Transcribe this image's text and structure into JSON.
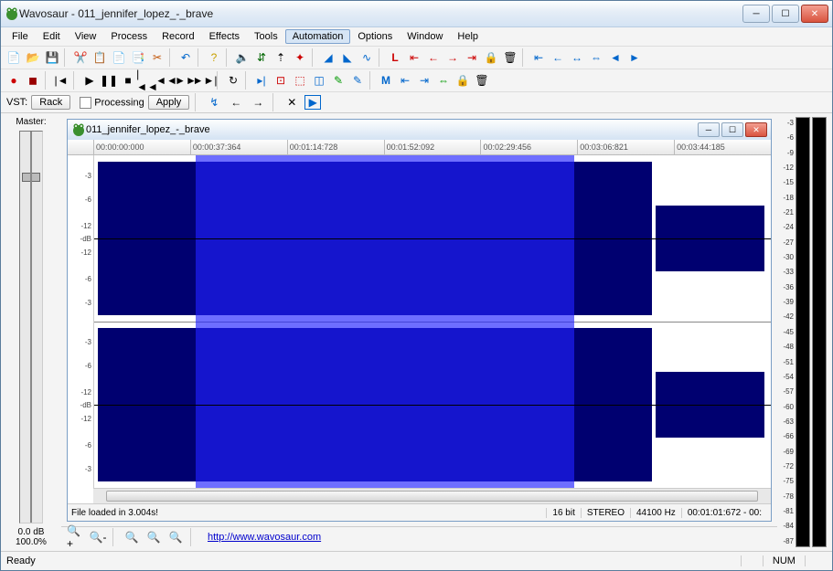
{
  "app": {
    "title": "Wavosaur - 011_jennifer_lopez_-_brave"
  },
  "menu": {
    "file": "File",
    "edit": "Edit",
    "view": "View",
    "process": "Process",
    "record": "Record",
    "effects": "Effects",
    "tools": "Tools",
    "automation": "Automation",
    "options": "Options",
    "window": "Window",
    "help": "Help"
  },
  "vstbar": {
    "label": "VST:",
    "rack": "Rack",
    "processing": "Processing",
    "apply": "Apply"
  },
  "master": {
    "label": "Master:",
    "db": "0.0 dB",
    "pct": "100.0%"
  },
  "child": {
    "title": "011_jennifer_lopez_-_brave"
  },
  "timeruler": [
    "00:00:00:000",
    "00:00:37:364",
    "00:01:14:728",
    "00:01:52:092",
    "00:02:29:456",
    "00:03:06:821",
    "00:03:44:185"
  ],
  "dbscale": [
    "-3",
    "-6",
    "-12",
    "-dB",
    "-12",
    "-6",
    "-3",
    "-3",
    "-6",
    "-12",
    "-dB",
    "-12",
    "-6",
    "-3"
  ],
  "childstatus": {
    "msg": "File loaded in 3.004s!",
    "bits": "16 bit",
    "chan": "STEREO",
    "rate": "44100 Hz",
    "pos": "00:01:01:672 - 00:"
  },
  "rightdb": [
    "-3",
    "-6",
    "-9",
    "-12",
    "-15",
    "-18",
    "-21",
    "-24",
    "-27",
    "-30",
    "-33",
    "-36",
    "-39",
    "-42",
    "-45",
    "-48",
    "-51",
    "-54",
    "-57",
    "-60",
    "-63",
    "-66",
    "-69",
    "-72",
    "-75",
    "-78",
    "-81",
    "-84",
    "-87"
  ],
  "link": "http://www.wavosaur.com",
  "status": {
    "ready": "Ready",
    "num": "NUM"
  }
}
